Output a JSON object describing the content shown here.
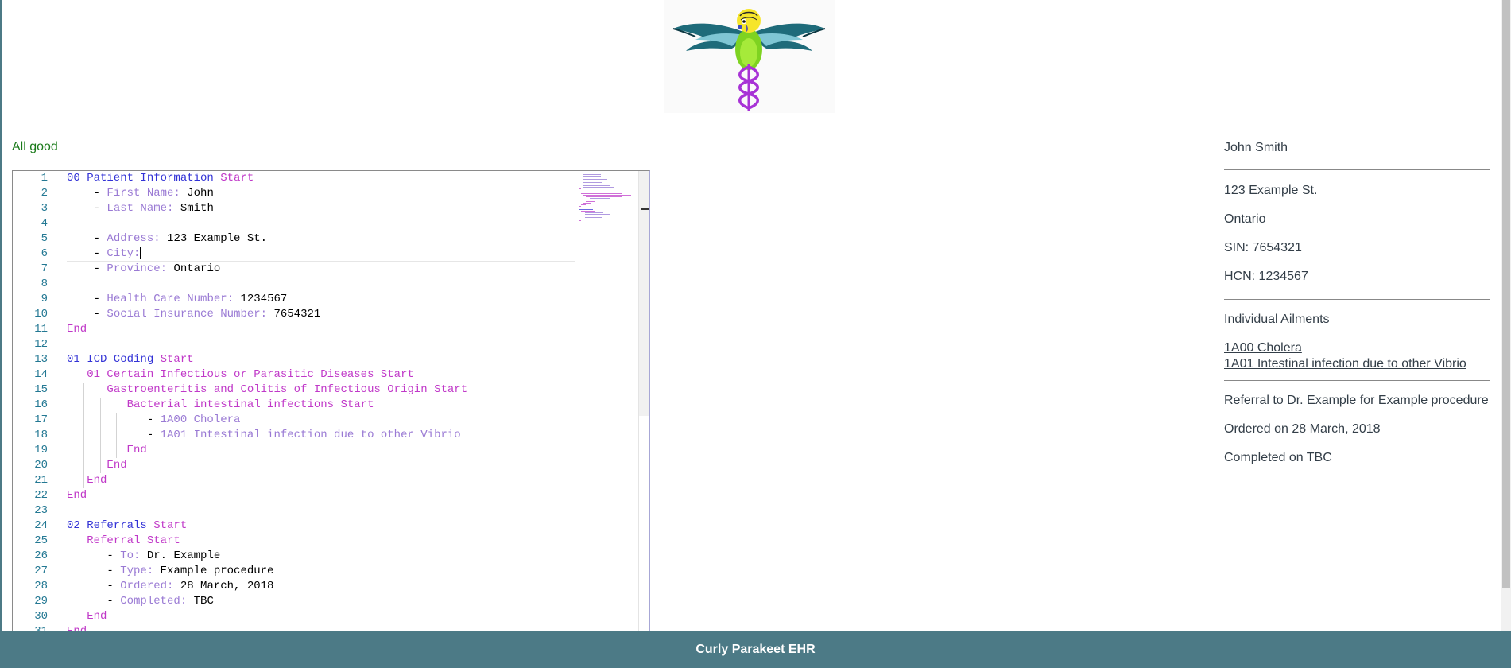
{
  "status": "All good",
  "editor": {
    "lines": [
      {
        "n": "1",
        "segs": [
          [
            "kw-blue",
            "00 Patient Information "
          ],
          [
            "kw-mag",
            "Start"
          ]
        ]
      },
      {
        "n": "2",
        "segs": [
          [
            "",
            "    - "
          ],
          [
            "fld",
            "First Name:"
          ],
          [
            "",
            " John"
          ]
        ]
      },
      {
        "n": "3",
        "segs": [
          [
            "",
            "    - "
          ],
          [
            "fld",
            "Last Name:"
          ],
          [
            "",
            " Smith"
          ]
        ]
      },
      {
        "n": "4",
        "segs": []
      },
      {
        "n": "5",
        "segs": [
          [
            "",
            "    - "
          ],
          [
            "fld",
            "Address:"
          ],
          [
            "",
            " 123 Example St."
          ]
        ]
      },
      {
        "n": "6",
        "segs": [
          [
            "",
            "    - "
          ],
          [
            "fld",
            "City:"
          ]
        ],
        "cursor": true
      },
      {
        "n": "7",
        "segs": [
          [
            "",
            "    - "
          ],
          [
            "fld",
            "Province:"
          ],
          [
            "",
            " Ontario"
          ]
        ]
      },
      {
        "n": "8",
        "segs": []
      },
      {
        "n": "9",
        "segs": [
          [
            "",
            "    - "
          ],
          [
            "fld",
            "Health Care Number:"
          ],
          [
            "",
            " 1234567"
          ]
        ]
      },
      {
        "n": "10",
        "segs": [
          [
            "",
            "    - "
          ],
          [
            "fld",
            "Social Insurance Number:"
          ],
          [
            "",
            " 7654321"
          ]
        ]
      },
      {
        "n": "11",
        "segs": [
          [
            "kw-mag",
            "End"
          ]
        ]
      },
      {
        "n": "12",
        "segs": []
      },
      {
        "n": "13",
        "segs": [
          [
            "kw-blue",
            "01 ICD Coding "
          ],
          [
            "kw-mag",
            "Start"
          ]
        ]
      },
      {
        "n": "14",
        "segs": [
          [
            "",
            "   "
          ],
          [
            "kw-mag",
            "01 Certain Infectious or Parasitic Diseases Start"
          ]
        ]
      },
      {
        "n": "15",
        "segs": [
          [
            "",
            "      "
          ],
          [
            "kw-mag",
            "Gastroenteritis and Colitis of Infectious Origin Start"
          ]
        ]
      },
      {
        "n": "16",
        "segs": [
          [
            "",
            "         "
          ],
          [
            "kw-mag",
            "Bacterial intestinal infections Start"
          ]
        ]
      },
      {
        "n": "17",
        "segs": [
          [
            "",
            "            - "
          ],
          [
            "fld",
            "1A00 Cholera"
          ]
        ]
      },
      {
        "n": "18",
        "segs": [
          [
            "",
            "            - "
          ],
          [
            "fld",
            "1A01 Intestinal infection due to other Vibrio"
          ]
        ]
      },
      {
        "n": "19",
        "segs": [
          [
            "",
            "         "
          ],
          [
            "kw-mag",
            "End"
          ]
        ]
      },
      {
        "n": "20",
        "segs": [
          [
            "",
            "      "
          ],
          [
            "kw-mag",
            "End"
          ]
        ]
      },
      {
        "n": "21",
        "segs": [
          [
            "",
            "   "
          ],
          [
            "kw-mag",
            "End"
          ]
        ]
      },
      {
        "n": "22",
        "segs": [
          [
            "kw-mag",
            "End"
          ]
        ]
      },
      {
        "n": "23",
        "segs": []
      },
      {
        "n": "24",
        "segs": [
          [
            "kw-blue",
            "02 Referrals "
          ],
          [
            "kw-mag",
            "Start"
          ]
        ]
      },
      {
        "n": "25",
        "segs": [
          [
            "",
            "   "
          ],
          [
            "kw-mag",
            "Referral Start"
          ]
        ]
      },
      {
        "n": "26",
        "segs": [
          [
            "",
            "      - "
          ],
          [
            "fld",
            "To:"
          ],
          [
            "",
            " Dr. Example"
          ]
        ]
      },
      {
        "n": "27",
        "segs": [
          [
            "",
            "      - "
          ],
          [
            "fld",
            "Type:"
          ],
          [
            "",
            " Example procedure"
          ]
        ]
      },
      {
        "n": "28",
        "segs": [
          [
            "",
            "      - "
          ],
          [
            "fld",
            "Ordered:"
          ],
          [
            "",
            " 28 March, 2018"
          ]
        ]
      },
      {
        "n": "29",
        "segs": [
          [
            "",
            "      - "
          ],
          [
            "fld",
            "Completed:"
          ],
          [
            "",
            " TBC"
          ]
        ]
      },
      {
        "n": "30",
        "segs": [
          [
            "",
            "   "
          ],
          [
            "kw-mag",
            "End"
          ]
        ]
      },
      {
        "n": "31",
        "segs": [
          [
            "kw-mag",
            "End"
          ]
        ]
      }
    ]
  },
  "sidebar": {
    "name": "John Smith",
    "address": "123 Example St.",
    "province": "Ontario",
    "sin": "SIN: 7654321",
    "hcn": "HCN: 1234567",
    "ailments_heading": "Individual Ailments",
    "ailments": [
      "1A00 Cholera",
      "1A01 Intestinal infection due to other Vibrio"
    ],
    "referral": "Referral to Dr. Example for Example procedure",
    "ordered": "Ordered on 28 March, 2018",
    "completed": "Completed on TBC"
  },
  "footer": "Curly Parakeet EHR",
  "colors": {
    "accent": "#4c7a86",
    "status_ok": "#1a7a1a",
    "keyword": "#3232d6",
    "section": "#c038c8",
    "field": "#9a7ad4",
    "line_number": "#237893"
  }
}
